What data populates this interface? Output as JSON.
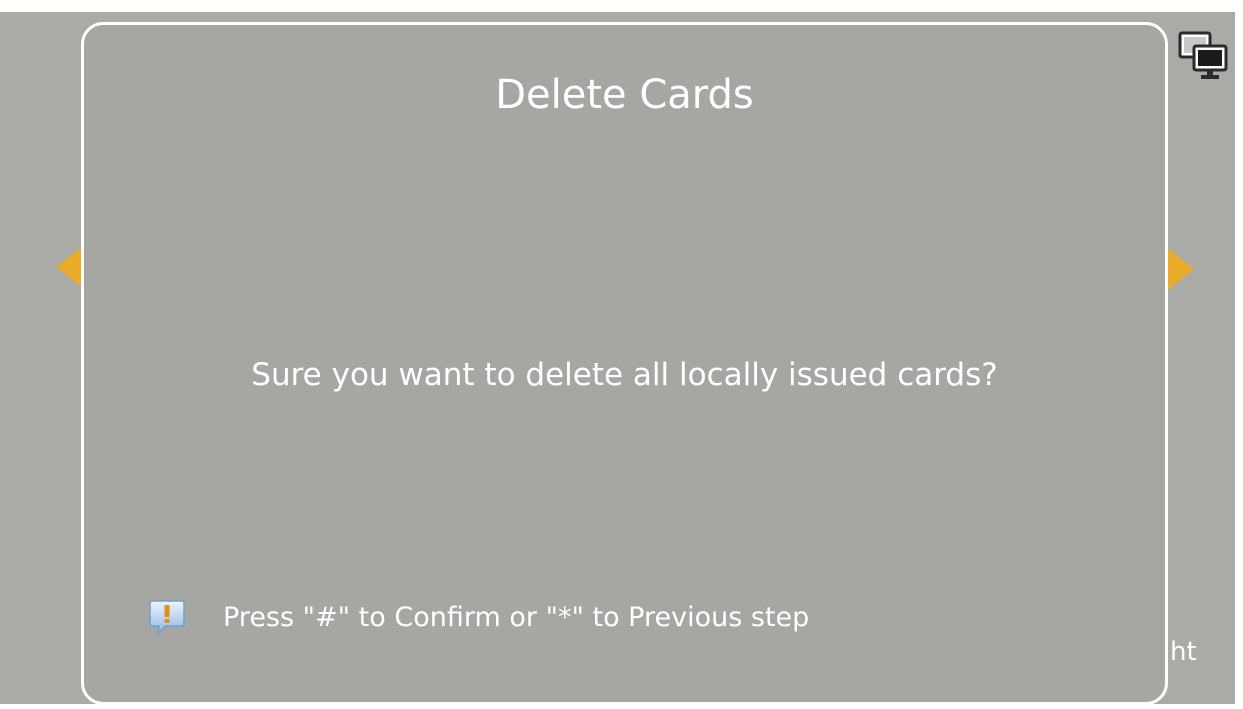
{
  "dialog": {
    "title": "Delete Cards",
    "message": "Sure you want to delete all locally issued cards?",
    "hint": "Press \"#\" to Confirm or \"*\" to Previous step",
    "hint_icon": "exclamation-speech-bubble-icon"
  },
  "navigation": {
    "prev_icon": "triangle-left-icon",
    "next_icon": "triangle-right-icon"
  },
  "status": {
    "display_icon": "dual-monitor-icon"
  },
  "background": {
    "peek_text": "ht"
  },
  "colors": {
    "background": "#aaaba6",
    "dialog": "#a6a7a2",
    "dialog_border": "#ffffff",
    "text": "#ffffff",
    "arrow_accent": "#e8ab2a",
    "hint_icon": "#8fb6e0"
  }
}
